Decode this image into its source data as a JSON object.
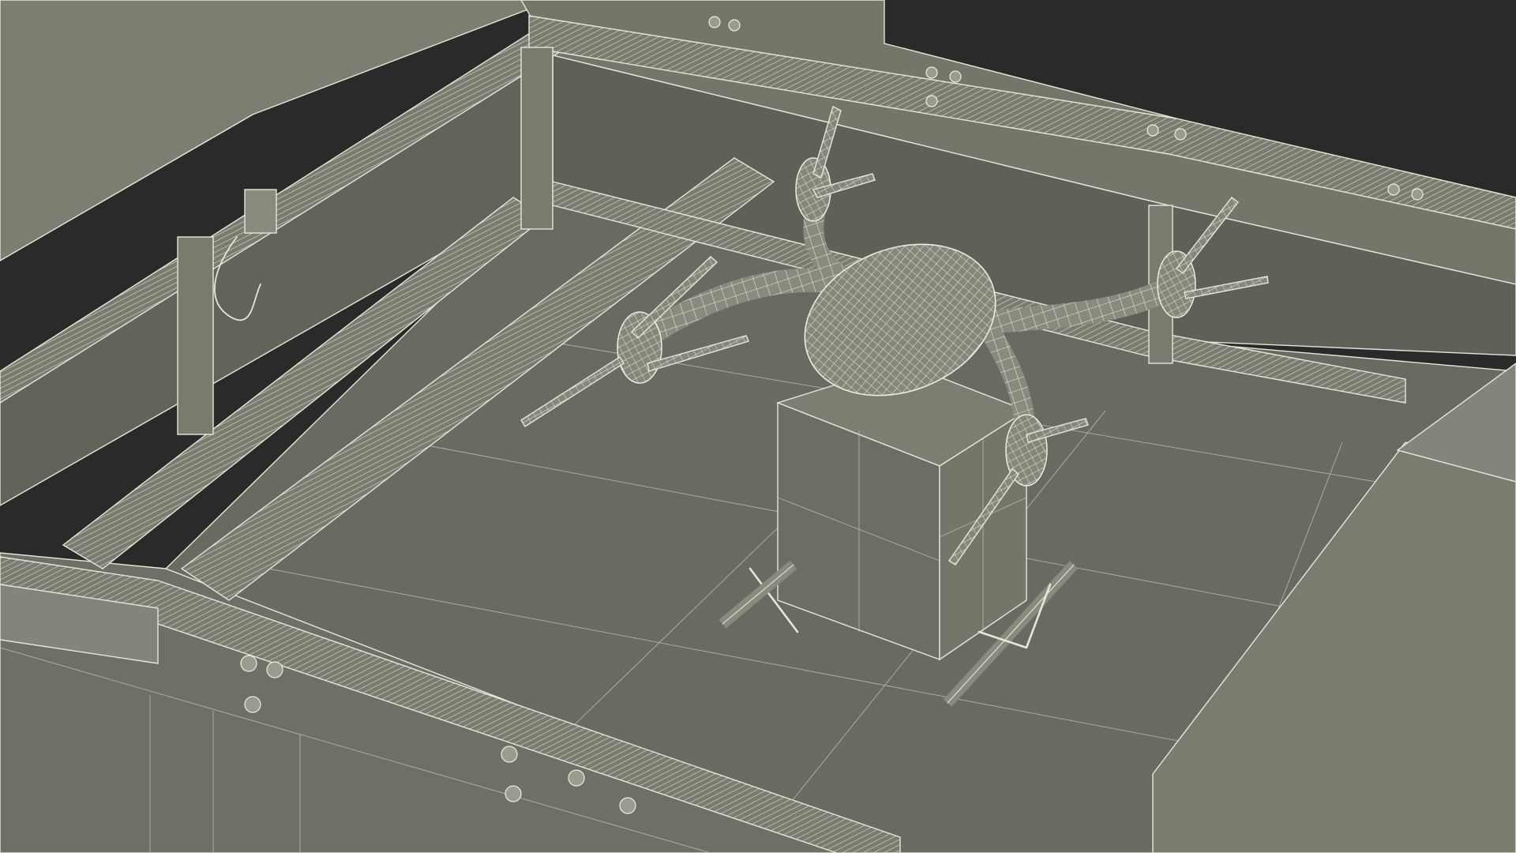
{
  "scene": {
    "subject": "quadcopter-drone-wireframe",
    "colors": {
      "background": "#2a2a2a",
      "floor": "#6a6b60",
      "panel": "#797a6e",
      "wall": "#5f6057",
      "wire": "#e6e6da"
    }
  }
}
